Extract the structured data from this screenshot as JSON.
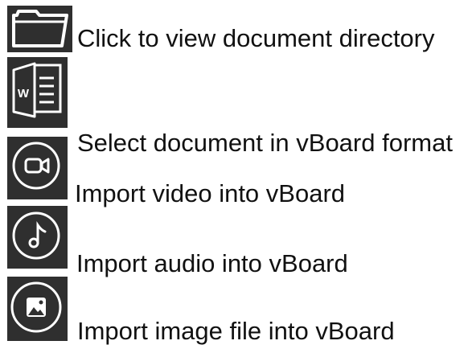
{
  "colors": {
    "icon_background": "#2f2f2f",
    "icon_foreground": "#ffffff",
    "text": "#111111",
    "page_background": "#ffffff"
  },
  "items": [
    {
      "icon": "folder-icon",
      "label": "Click to view document directory"
    },
    {
      "icon": "word-document-icon",
      "label": "Select document in vBoard format"
    },
    {
      "icon": "video-camera-icon",
      "label": "Import video into vBoard"
    },
    {
      "icon": "music-note-icon",
      "label": "Import audio into vBoard"
    },
    {
      "icon": "image-icon",
      "label": "Import image file into vBoard"
    }
  ]
}
